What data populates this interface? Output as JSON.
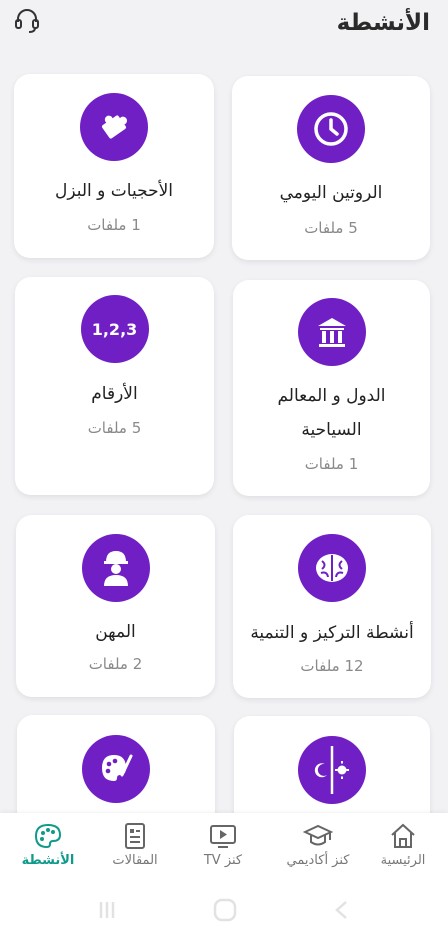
{
  "header": {
    "title": "الأنشطة"
  },
  "cards": [
    {
      "title_line1": "الروتين اليومي",
      "title_line2": "",
      "files": "5 ملفات",
      "icon": "clock-icon"
    },
    {
      "title_line1": "الأحجيات و البزل",
      "title_line2": "",
      "files": "1 ملفات",
      "icon": "puzzle-icon"
    },
    {
      "title_line1": "الدول و المعالم",
      "title_line2": "السياحية",
      "files": "1 ملفات",
      "icon": "landmark-icon"
    },
    {
      "title_line1": "الأرقام",
      "title_line2": "",
      "files": "5 ملفات",
      "icon": "numbers-icon",
      "icon_text": "1,2,3"
    },
    {
      "title_line1": "أنشطة التركيز و التنمية",
      "title_line2": "",
      "files": "12 ملفات",
      "icon": "brain-icon"
    },
    {
      "title_line1": "المهن",
      "title_line2": "",
      "files": "2 ملفات",
      "icon": "worker-icon"
    },
    {
      "title_line1": "",
      "title_line2": "",
      "files": "",
      "icon": "day-night-icon"
    },
    {
      "title_line1": "",
      "title_line2": "",
      "files": "",
      "icon": "art-palette-icon"
    }
  ],
  "nav": {
    "home": "الرئيسية",
    "academic": "كنز أكاديمي",
    "tv": "كنز TV",
    "articles": "المقالات",
    "activities": "الأنشطة"
  },
  "colors": {
    "accent": "#6f1fc4",
    "active": "#0f9a8c"
  }
}
